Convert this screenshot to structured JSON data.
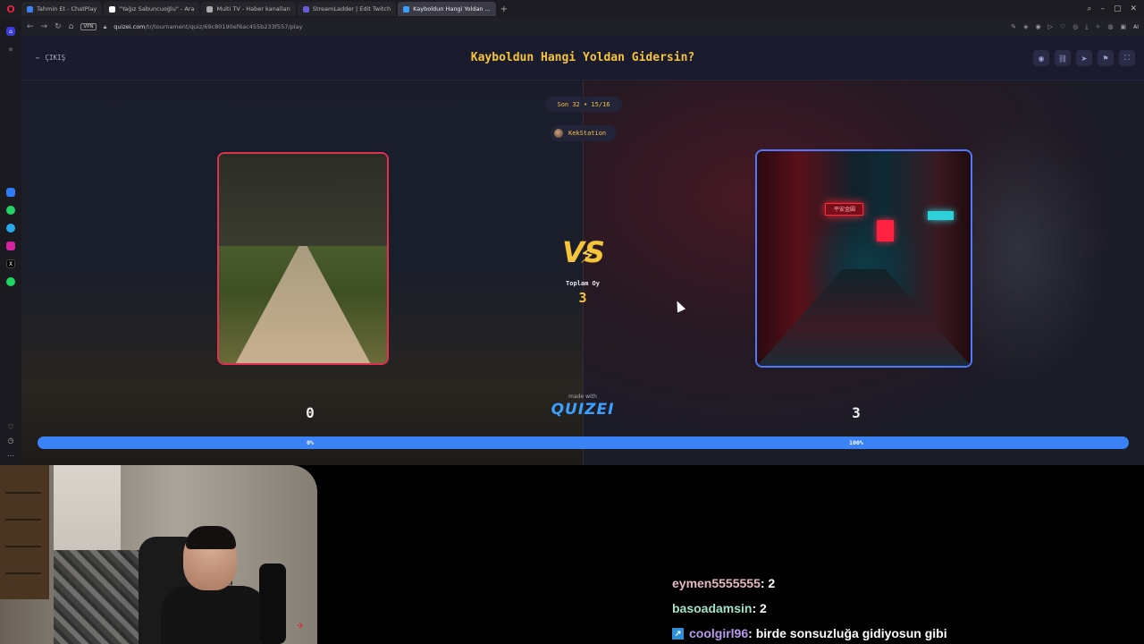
{
  "browser": {
    "tabs": [
      {
        "label": "Tahmin Et - ChatPlay",
        "color": "#3b82f6"
      },
      {
        "label": "\"Yağız Sabuncuoğlu\" - Ara",
        "color": "#ffffff"
      },
      {
        "label": "Multi TV - Haber kanalları",
        "color": "#aaaaaa"
      },
      {
        "label": "StreamLadder | Edit Twitch",
        "color": "#6b5bd6"
      },
      {
        "label": "Kayboldun Hangi Yoldan ...",
        "color": "#3aa0ff",
        "active": true
      }
    ],
    "vpn": "VPN",
    "url_domain": "quizei.com",
    "url_path": "/tr/tournament/quiz/69c80190ef6ac455b233f557/play",
    "ai_label": "AI"
  },
  "quiz": {
    "exit_label": "ÇIKIŞ",
    "title": "Kayboldun Hangi Yoldan Gidersin?",
    "round": "Son 32 • 15/16",
    "author": "KekStation",
    "vs": "VS",
    "total_label": "Toplam Oy",
    "total_value": "3",
    "made_with": "made with",
    "logo": "QUIZEI",
    "left_score": "0",
    "right_score": "3",
    "left_percent_label": "0%",
    "right_percent_label": "100%",
    "left_share": 0,
    "right_share": 1,
    "accent": "#f5c43b",
    "left_color": "#e0314f",
    "right_color": "#4f78ff",
    "neon_sign": "平安金圓"
  },
  "chat": [
    {
      "user": "eymen5555555",
      "text": " : 2",
      "color": "#e8b7c4",
      "badge": false
    },
    {
      "user": "basoadamsin",
      "text": " : 2",
      "color": "#9fe3c4",
      "badge": false
    },
    {
      "user": "coolgirl96",
      "text": " : birde sonsuzluğa gidiyosun gibi",
      "color": "#b99af0",
      "badge": true
    }
  ]
}
